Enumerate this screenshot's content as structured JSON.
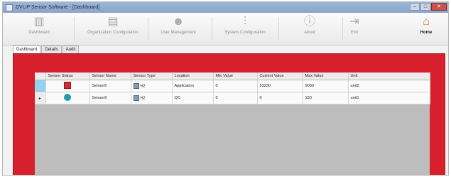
{
  "window": {
    "title": "DVLIP Sensor Software - [Dashboard]",
    "controls": {
      "minimize": "–",
      "maximize": "□",
      "close": "✕"
    }
  },
  "toolbar": {
    "items": [
      {
        "label": "Dashboard",
        "icon": "chart-icon"
      },
      {
        "label": "Organization Configuration",
        "icon": "document-icon"
      },
      {
        "label": "User Management",
        "icon": "users-icon"
      },
      {
        "label": "System Configuration",
        "icon": "sliders-icon"
      },
      {
        "label": "About",
        "icon": "info-icon"
      },
      {
        "label": "Exit",
        "icon": "exit-icon"
      },
      {
        "label": "Home",
        "icon": "home-icon"
      }
    ]
  },
  "tabs": [
    {
      "label": "Dashboard",
      "active": true
    },
    {
      "label": "Details",
      "active": false
    },
    {
      "label": "Audit",
      "active": false
    }
  ],
  "table": {
    "columns": [
      "Sensor Status",
      "Sensor Name",
      "Sensor Type",
      "Location",
      "Min Value",
      "Current Value",
      "Max Value",
      "Unit"
    ],
    "rows": [
      {
        "marker": "",
        "status": "red-square",
        "name": "Sensor6",
        "type": "H2",
        "location": "Application",
        "min": "0",
        "current": "53230",
        "max": "5000",
        "unit": "unit2"
      },
      {
        "marker": "▸",
        "status": "teal-circle",
        "name": "Sensor6",
        "type": "H2",
        "location": "QC",
        "min": "0",
        "current": "0",
        "max": "150",
        "unit": "unit1"
      }
    ]
  },
  "colors": {
    "dashboard_background": "#d7202c",
    "status_red": "#d42a30",
    "status_teal": "#1f9ea9",
    "selected_row_header": "#8fd3ee"
  }
}
